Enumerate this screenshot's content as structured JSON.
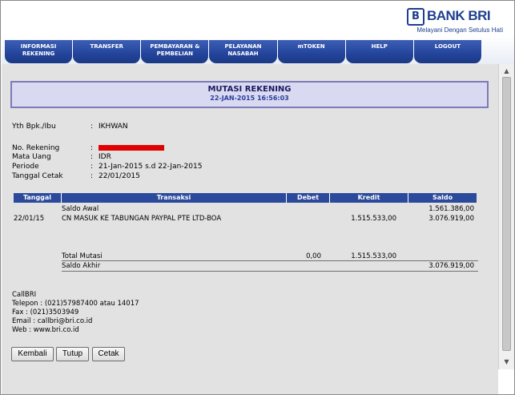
{
  "brand": {
    "logo_mark": "B",
    "name": "BANK BRI",
    "tagline": "Melayani Dengan Setulus Hati"
  },
  "nav": [
    "INFORMASI\nREKENING",
    "TRANSFER",
    "PEMBAYARAN &\nPEMBELIAN",
    "PELAYANAN\nNASABAH",
    "mTOKEN",
    "HELP",
    "LOGOUT"
  ],
  "statement": {
    "title": "MUTASI REKENING",
    "datetime": "22-JAN-2015 16:56:03"
  },
  "customer": {
    "greeting_label": "Yth Bpk./Ibu",
    "greeting_value": "IKHWAN",
    "account_label": "No. Rekening",
    "currency_label": "Mata Uang",
    "currency_value": "IDR",
    "period_label": "Periode",
    "period_value": "21-Jan-2015 s.d 22-Jan-2015",
    "print_date_label": "Tanggal Cetak",
    "print_date_value": "22/01/2015",
    "separator": ":"
  },
  "table": {
    "headers": [
      "Tanggal",
      "Transaksi",
      "Debet",
      "Kredit",
      "Saldo"
    ],
    "opening": {
      "label": "Saldo Awal",
      "saldo": "1.561.386,00"
    },
    "rows": [
      {
        "date": "22/01/15",
        "desc": "CN MASUK KE TABUNGAN PAYPAL PTE LTD-BOA",
        "debet": "",
        "kredit": "1.515.533,00",
        "saldo": "3.076.919,00"
      }
    ],
    "total": {
      "label": "Total Mutasi",
      "debet": "0,00",
      "kredit": "1.515.533,00"
    },
    "closing": {
      "label": "Saldo Akhir",
      "saldo": "3.076.919,00"
    }
  },
  "contact": {
    "name": "CallBRI",
    "phone": "Telepon : (021)57987400 atau 14017",
    "fax": "Fax : (021)3503949",
    "email": "Email : callbri@bri.co.id",
    "web": "Web : www.bri.co.id"
  },
  "buttons": {
    "back": "Kembali",
    "close": "Tutup",
    "print": "Cetak"
  },
  "scrollbar": {
    "up": "▲",
    "down": "▼"
  }
}
